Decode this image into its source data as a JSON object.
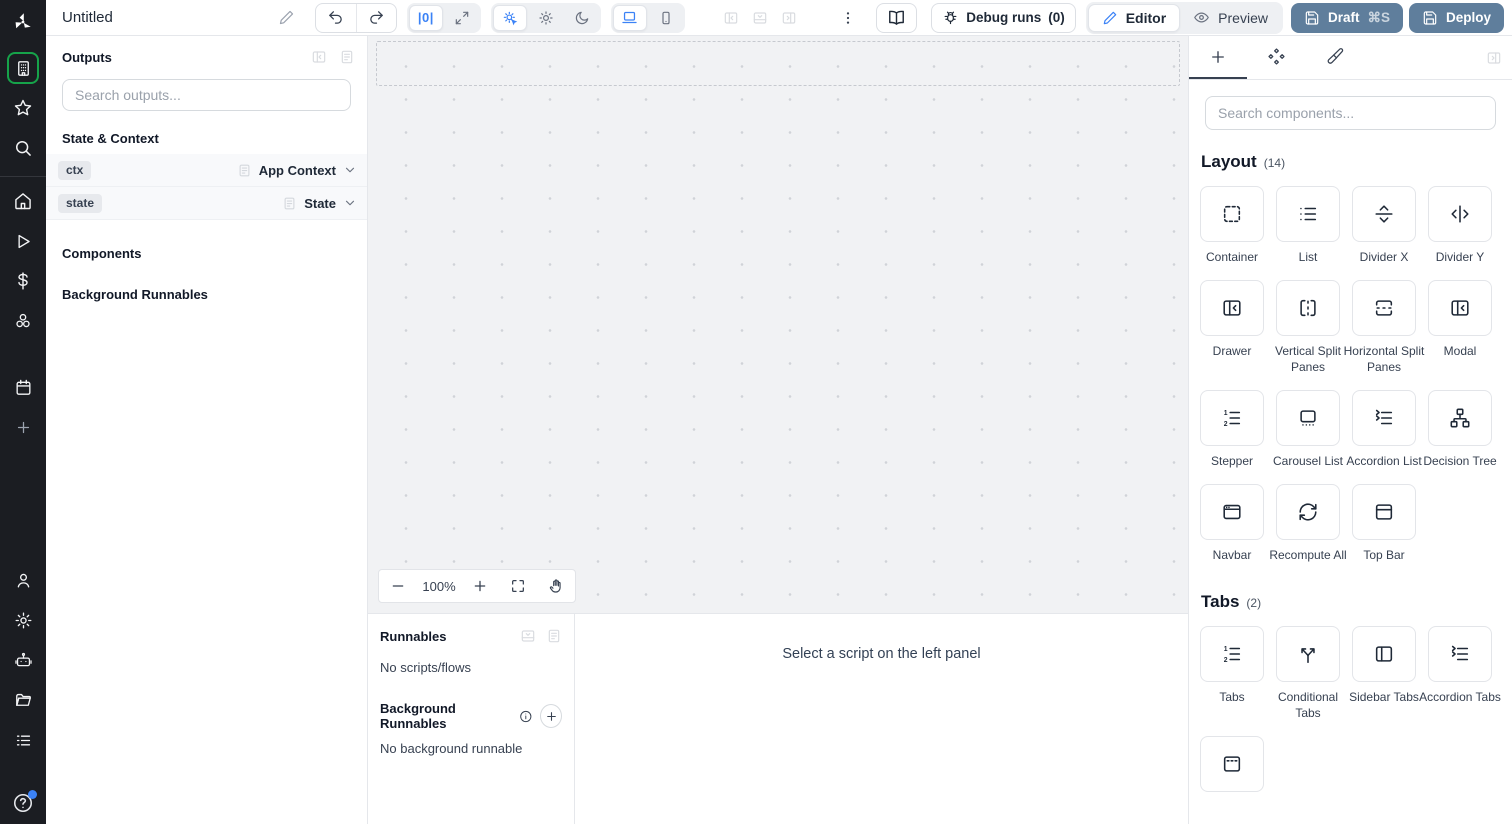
{
  "topbar": {
    "title": "Untitled",
    "width_label": "|0|",
    "debug": {
      "label": "Debug runs",
      "count": "(0)"
    },
    "mode": {
      "editor": "Editor",
      "preview": "Preview"
    },
    "draft": {
      "label": "Draft",
      "shortcut": "⌘S"
    },
    "deploy": {
      "label": "Deploy"
    },
    "icons": [
      "edit-pencil-icon",
      "undo-icon",
      "redo-icon",
      "fit-width-icon",
      "maximize-icon",
      "sun-auto-icon",
      "sun-icon",
      "moon-icon",
      "laptop-icon",
      "smartphone-icon",
      "panel-left-icon",
      "panel-bottom-icon",
      "panel-right-icon",
      "kebab-menu-icon",
      "book-open-icon",
      "bug-icon",
      "eye-icon",
      "save-icon"
    ]
  },
  "sidebar": {
    "icons": [
      "windmill-logo",
      "building-icon",
      "star-icon",
      "search-icon",
      "home-icon",
      "play-icon",
      "dollar-icon",
      "resources-icon",
      "calendar-icon",
      "plus-icon",
      "user-icon",
      "gear-icon",
      "robot-icon",
      "folder-icon",
      "list-icon",
      "help-circle-icon"
    ]
  },
  "outputs": {
    "title": "Outputs",
    "search_placeholder": "Search outputs...",
    "state_context_header": "State & Context",
    "rows": [
      {
        "badge": "ctx",
        "value": "App Context"
      },
      {
        "badge": "state",
        "value": "State"
      }
    ],
    "components_header": "Components",
    "background_header": "Background Runnables"
  },
  "canvas": {
    "zoom_level": "100%"
  },
  "runnables": {
    "title": "Runnables",
    "empty_scripts": "No scripts/flows",
    "background_title": "Background Runnables",
    "empty_background": "No background runnable",
    "select_hint": "Select a script on the left panel"
  },
  "components": {
    "search_placeholder": "Search components...",
    "sections": [
      {
        "title": "Layout",
        "count": "(14)",
        "items": [
          {
            "label": "Container",
            "icon": "container-icon"
          },
          {
            "label": "List",
            "icon": "list-icon"
          },
          {
            "label": "Divider X",
            "icon": "divider-x-icon"
          },
          {
            "label": "Divider Y",
            "icon": "divider-y-icon"
          },
          {
            "label": "Drawer",
            "icon": "drawer-icon"
          },
          {
            "label": "Vertical Split Panes",
            "icon": "vertical-split-icon"
          },
          {
            "label": "Horizontal Split Panes",
            "icon": "horizontal-split-icon"
          },
          {
            "label": "Modal",
            "icon": "modal-icon"
          },
          {
            "label": "Stepper",
            "icon": "stepper-icon"
          },
          {
            "label": "Carousel List",
            "icon": "carousel-icon"
          },
          {
            "label": "Accordion List",
            "icon": "accordion-list-icon"
          },
          {
            "label": "Decision Tree",
            "icon": "decision-tree-icon"
          },
          {
            "label": "Navbar",
            "icon": "navbar-icon"
          },
          {
            "label": "Recompute All",
            "icon": "recompute-icon"
          },
          {
            "label": "Top Bar",
            "icon": "top-bar-icon"
          }
        ]
      },
      {
        "title": "Tabs",
        "count": "(2)",
        "items": [
          {
            "label": "Tabs",
            "icon": "tabs-icon"
          },
          {
            "label": "Conditional Tabs",
            "icon": "conditional-tabs-icon"
          },
          {
            "label": "Sidebar Tabs",
            "icon": "sidebar-tabs-icon"
          },
          {
            "label": "Accordion Tabs",
            "icon": "accordion-tabs-icon"
          },
          {
            "label": "",
            "icon": "window-dashed-icon"
          }
        ]
      }
    ]
  },
  "colors": {
    "sidebar_bg": "#1b1d22",
    "accent_green": "#16a34a",
    "primary_button": "#5f7e9c",
    "active_blue": "#3b82f6",
    "canvas_bg": "#f1f2f4",
    "notification_dot": "#3b82f6"
  }
}
